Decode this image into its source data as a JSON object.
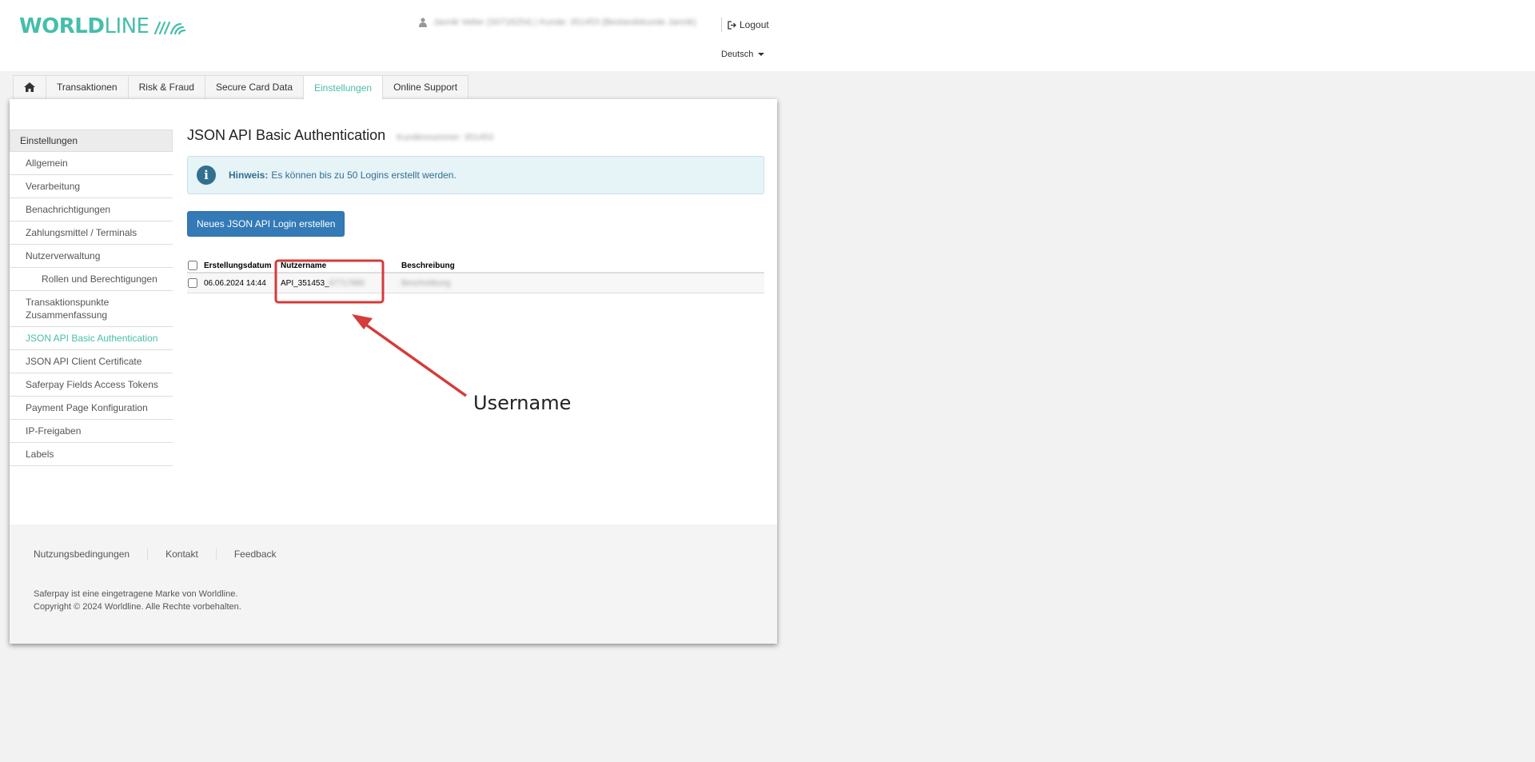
{
  "brand": {
    "name_bold": "WORLD",
    "name_light": "LINE",
    "color": "#46beaa"
  },
  "header": {
    "user_info": "Jannik Vetter (S0718254) | Kunde: 351453 (Bestandskunde Jannik)",
    "logout_label": "Logout",
    "language": "Deutsch"
  },
  "nav": {
    "home_icon": "home-icon",
    "tabs": [
      "Transaktionen",
      "Risk & Fraud",
      "Secure Card Data",
      "Einstellungen",
      "Online Support"
    ],
    "active_tab": "Einstellungen"
  },
  "sidebar": {
    "header": "Einstellungen",
    "items": [
      "Allgemein",
      "Verarbeitung",
      "Benachrichtigungen",
      "Zahlungsmittel / Terminals",
      "Nutzerverwaltung",
      "Rollen und Berechtigungen",
      "Transaktionspunkte Zusammenfassung",
      "JSON API Basic Authentication",
      "JSON API Client Certificate",
      "Saferpay Fields Access Tokens",
      "Payment Page Konfiguration",
      "IP-Freigaben",
      "Labels"
    ],
    "active_item": "JSON API Basic Authentication"
  },
  "main": {
    "title": "JSON API Basic Authentication",
    "title_sub": "Kundennummer: 351453",
    "notice_label": "Hinweis:",
    "notice_text": "Es können bis zu 50 Logins erstellt werden.",
    "create_button": "Neues JSON API Login erstellen",
    "table": {
      "columns": [
        "Erstellungsdatum",
        "Nutzername",
        "Beschreibung"
      ],
      "rows": [
        {
          "date": "06.06.2024 14:44",
          "username_visible": "API_351453_",
          "username_hidden": "87717885",
          "description": "Beschreibung"
        }
      ]
    }
  },
  "footer": {
    "links": [
      "Nutzungsbedingungen",
      "Kontakt",
      "Feedback"
    ],
    "note_line1": "Saferpay ist eine eingetragene Marke von Worldline.",
    "note_line2": "Copyright © 2024 Worldline. Alle Rechte vorbehalten."
  },
  "annotation": {
    "label": "Username",
    "color": "#d63a3a"
  }
}
